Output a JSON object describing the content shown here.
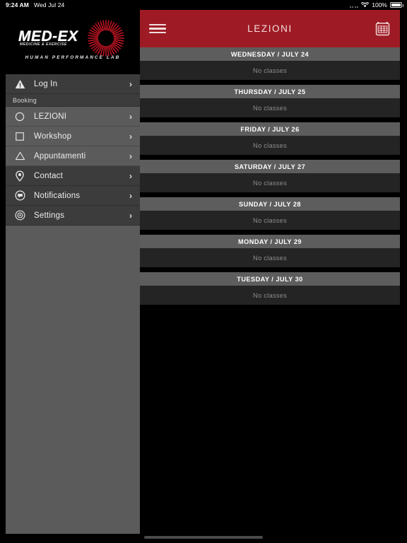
{
  "status_bar": {
    "time": "9:24 AM",
    "date": "Wed Jul 24",
    "battery_percent": "100%",
    "wifi_icon": "wifi-icon",
    "signal_icon": "signal-dots-icon",
    "battery_icon": "battery-full-icon"
  },
  "brand": {
    "wordmark": "MED-EX",
    "tagline": "MEDICINE & EXERCISE",
    "subtitle": "HUMAN PERFORMANCE LAB",
    "accent_color": "#b3131f",
    "logo_bg": "#000000"
  },
  "sidebar": {
    "login": {
      "label": "Log In",
      "icon": "warning-triangle-icon",
      "chevron": "›"
    },
    "section_label": "Booking",
    "items": [
      {
        "label": "LEZIONI",
        "icon": "circle-icon",
        "chevron": "›",
        "group": "booking"
      },
      {
        "label": "Workshop",
        "icon": "square-icon",
        "chevron": "›",
        "group": "booking"
      },
      {
        "label": "Appuntamenti",
        "icon": "triangle-icon",
        "chevron": "›",
        "group": "booking"
      },
      {
        "label": "Contact",
        "icon": "map-pin-icon",
        "chevron": "›",
        "group": "other"
      },
      {
        "label": "Notifications",
        "icon": "speech-bubble-icon",
        "chevron": "›",
        "group": "other"
      },
      {
        "label": "Settings",
        "icon": "target-icon",
        "chevron": "›",
        "group": "other"
      }
    ]
  },
  "topbar": {
    "title": "LEZIONI",
    "menu_icon": "hamburger-menu-icon",
    "calendar_icon": "calendar-icon",
    "bg_color": "#9e1b25"
  },
  "schedule": {
    "empty_text": "No classes",
    "days": [
      {
        "header": "WEDNESDAY / JULY 24",
        "classes": "No classes"
      },
      {
        "header": "THURSDAY / JULY 25",
        "classes": "No classes"
      },
      {
        "header": "FRIDAY / JULY 26",
        "classes": "No classes"
      },
      {
        "header": "SATURDAY / JULY 27",
        "classes": "No classes"
      },
      {
        "header": "SUNDAY / JULY 28",
        "classes": "No classes"
      },
      {
        "header": "MONDAY / JULY 29",
        "classes": "No classes"
      },
      {
        "header": "TUESDAY / JULY 30",
        "classes": "No classes"
      }
    ]
  }
}
